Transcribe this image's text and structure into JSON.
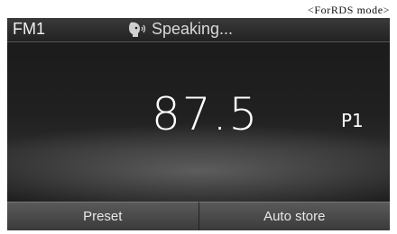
{
  "caption": "<ForRDS mode>",
  "header": {
    "band": "FM1",
    "status": "Speaking..."
  },
  "display": {
    "frequency": "87.5",
    "preset": "P1"
  },
  "buttons": {
    "preset": "Preset",
    "auto_store": "Auto store"
  },
  "icons": {
    "status_icon": "voice-speaking-icon"
  }
}
